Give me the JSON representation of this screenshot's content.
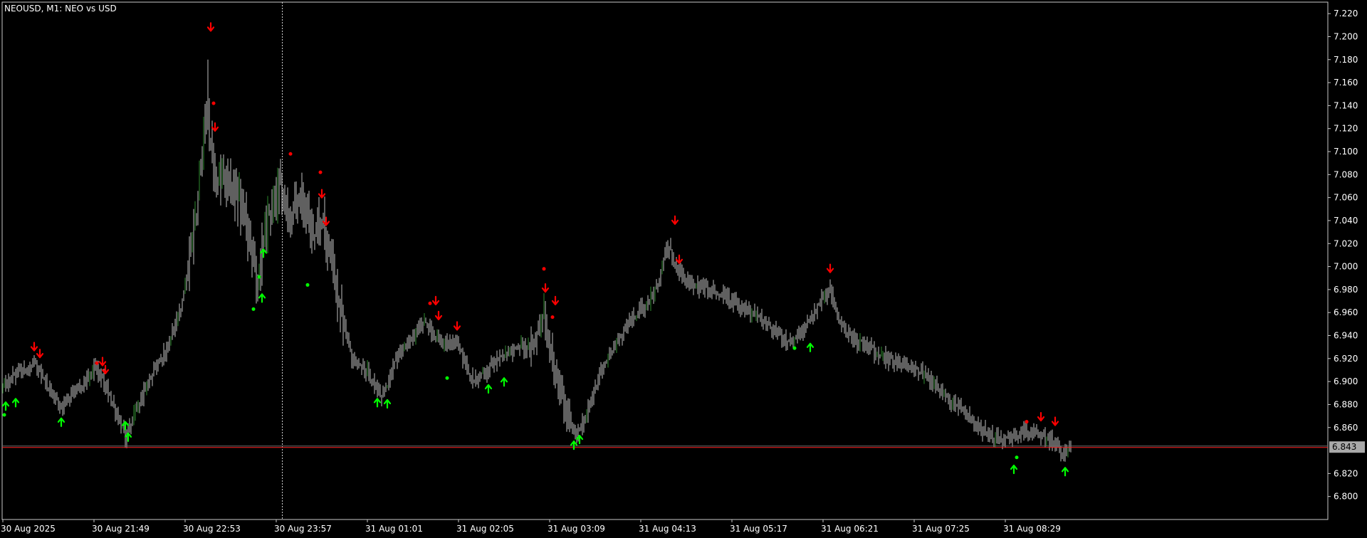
{
  "chart_title": "NEOUSD, M1:  NEO vs USD",
  "colors": {
    "background": "#000000",
    "frame": "#c8c8c8",
    "bar": "#c0c0c0",
    "bar_up_accent": "#2e8b2e",
    "bid_line": "#ff2020",
    "ask_line": "#6b6b6b",
    "price_tag": "#a9a9a9",
    "buy_arrow": "#00ff00",
    "sell_arrow": "#ff0000",
    "crosshair": "#d0d0d0",
    "axis_text": "#ffffff"
  },
  "chart_data": {
    "type": "ohlc",
    "symbol": "NEOUSD",
    "timeframe": "M1",
    "description": "NEO vs USD",
    "ylim": [
      6.78,
      7.23
    ],
    "y_ticks": [
      "7.220",
      "7.200",
      "7.180",
      "7.160",
      "7.140",
      "7.120",
      "7.100",
      "7.080",
      "7.060",
      "7.040",
      "7.020",
      "7.000",
      "6.980",
      "6.960",
      "6.940",
      "6.920",
      "6.900",
      "6.880",
      "6.860",
      "6.843",
      "6.820",
      "6.800"
    ],
    "x_ticks": [
      "30 Aug 2025",
      "30 Aug 21:49",
      "30 Aug 22:53",
      "30 Aug 23:57",
      "31 Aug 01:01",
      "31 Aug 02:05",
      "31 Aug 03:09",
      "31 Aug 04:13",
      "31 Aug 05:17",
      "31 Aug 06:21",
      "31 Aug 07:25",
      "31 Aug 08:29"
    ],
    "x_tick_index": [
      0,
      64,
      128,
      192,
      256,
      320,
      384,
      448,
      512,
      576,
      640,
      704
    ],
    "bar_count": 751,
    "current_price": 6.843,
    "current_price_label": "6.843",
    "crosshair_bar_index": 196,
    "grid": false,
    "price_path": [
      [
        0,
        6.895
      ],
      [
        8,
        6.905
      ],
      [
        22,
        6.915
      ],
      [
        40,
        6.878
      ],
      [
        55,
        6.897
      ],
      [
        65,
        6.912
      ],
      [
        72,
        6.897
      ],
      [
        86,
        6.852
      ],
      [
        96,
        6.882
      ],
      [
        106,
        6.91
      ],
      [
        115,
        6.93
      ],
      [
        125,
        6.96
      ],
      [
        135,
        7.04
      ],
      [
        143,
        7.135
      ],
      [
        150,
        7.07
      ],
      [
        160,
        7.075
      ],
      [
        170,
        7.04
      ],
      [
        178,
        6.985
      ],
      [
        186,
        7.045
      ],
      [
        194,
        7.07
      ],
      [
        202,
        7.045
      ],
      [
        210,
        7.065
      ],
      [
        216,
        7.03
      ],
      [
        224,
        7.04
      ],
      [
        236,
        6.97
      ],
      [
        245,
        6.92
      ],
      [
        255,
        6.91
      ],
      [
        266,
        6.885
      ],
      [
        276,
        6.92
      ],
      [
        286,
        6.935
      ],
      [
        296,
        6.953
      ],
      [
        306,
        6.935
      ],
      [
        320,
        6.93
      ],
      [
        330,
        6.9
      ],
      [
        345,
        6.915
      ],
      [
        360,
        6.93
      ],
      [
        373,
        6.93
      ],
      [
        380,
        6.965
      ],
      [
        386,
        6.915
      ],
      [
        396,
        6.872
      ],
      [
        402,
        6.855
      ],
      [
        410,
        6.87
      ],
      [
        420,
        6.91
      ],
      [
        432,
        6.935
      ],
      [
        442,
        6.955
      ],
      [
        454,
        6.97
      ],
      [
        460,
        6.985
      ],
      [
        467,
        7.02
      ],
      [
        474,
        6.995
      ],
      [
        484,
        6.985
      ],
      [
        496,
        6.98
      ],
      [
        506,
        6.975
      ],
      [
        518,
        6.965
      ],
      [
        532,
        6.955
      ],
      [
        545,
        6.94
      ],
      [
        555,
        6.935
      ],
      [
        562,
        6.945
      ],
      [
        572,
        6.965
      ],
      [
        580,
        6.98
      ],
      [
        590,
        6.945
      ],
      [
        600,
        6.935
      ],
      [
        614,
        6.925
      ],
      [
        628,
        6.915
      ],
      [
        646,
        6.908
      ],
      [
        660,
        6.89
      ],
      [
        670,
        6.88
      ],
      [
        680,
        6.865
      ],
      [
        690,
        6.855
      ],
      [
        700,
        6.848
      ],
      [
        708,
        6.85
      ],
      [
        716,
        6.858
      ],
      [
        726,
        6.853
      ],
      [
        734,
        6.85
      ],
      [
        740,
        6.843
      ],
      [
        744,
        6.837
      ],
      [
        750,
        6.845
      ]
    ],
    "spikes": [
      {
        "bar": 144,
        "high": 7.18
      },
      {
        "bar": 381,
        "high": 6.97
      },
      {
        "bar": 469,
        "high": 7.025
      }
    ],
    "buy_arrows": [
      {
        "bar": 2,
        "price": 6.882
      },
      {
        "bar": 9,
        "price": 6.885
      },
      {
        "bar": 41,
        "price": 6.868
      },
      {
        "bar": 86,
        "price": 6.865
      },
      {
        "bar": 88,
        "price": 6.855
      },
      {
        "bar": 182,
        "price": 6.976
      },
      {
        "bar": 183,
        "price": 7.015
      },
      {
        "bar": 263,
        "price": 6.885
      },
      {
        "bar": 270,
        "price": 6.884
      },
      {
        "bar": 341,
        "price": 6.897
      },
      {
        "bar": 352,
        "price": 6.903
      },
      {
        "bar": 401,
        "price": 6.848
      },
      {
        "bar": 405,
        "price": 6.853
      },
      {
        "bar": 567,
        "price": 6.933
      },
      {
        "bar": 710,
        "price": 6.827
      },
      {
        "bar": 746,
        "price": 6.825
      }
    ],
    "buy_dots": [
      {
        "bar": 1,
        "price": 6.871
      },
      {
        "bar": 176,
        "price": 6.963
      },
      {
        "bar": 180,
        "price": 6.991
      },
      {
        "bar": 214,
        "price": 6.984
      },
      {
        "bar": 312,
        "price": 6.903
      },
      {
        "bar": 556,
        "price": 6.929
      },
      {
        "bar": 712,
        "price": 6.834
      }
    ],
    "sell_arrows": [
      {
        "bar": 22,
        "price": 6.927
      },
      {
        "bar": 26,
        "price": 6.921
      },
      {
        "bar": 70,
        "price": 6.914
      },
      {
        "bar": 72,
        "price": 6.907
      },
      {
        "bar": 146,
        "price": 7.205
      },
      {
        "bar": 149,
        "price": 7.118
      },
      {
        "bar": 224,
        "price": 7.06
      },
      {
        "bar": 227,
        "price": 7.036
      },
      {
        "bar": 304,
        "price": 6.967
      },
      {
        "bar": 306,
        "price": 6.954
      },
      {
        "bar": 319,
        "price": 6.945
      },
      {
        "bar": 381,
        "price": 6.978
      },
      {
        "bar": 388,
        "price": 6.967
      },
      {
        "bar": 472,
        "price": 7.037
      },
      {
        "bar": 475,
        "price": 7.003
      },
      {
        "bar": 581,
        "price": 6.995
      },
      {
        "bar": 729,
        "price": 6.866
      },
      {
        "bar": 739,
        "price": 6.862
      }
    ],
    "sell_dots": [
      {
        "bar": 66,
        "price": 6.916
      },
      {
        "bar": 148,
        "price": 7.142
      },
      {
        "bar": 202,
        "price": 7.098
      },
      {
        "bar": 223,
        "price": 7.082
      },
      {
        "bar": 300,
        "price": 6.968
      },
      {
        "bar": 380,
        "price": 6.998
      },
      {
        "bar": 386,
        "price": 6.956
      },
      {
        "bar": 719,
        "price": 6.865
      }
    ]
  }
}
